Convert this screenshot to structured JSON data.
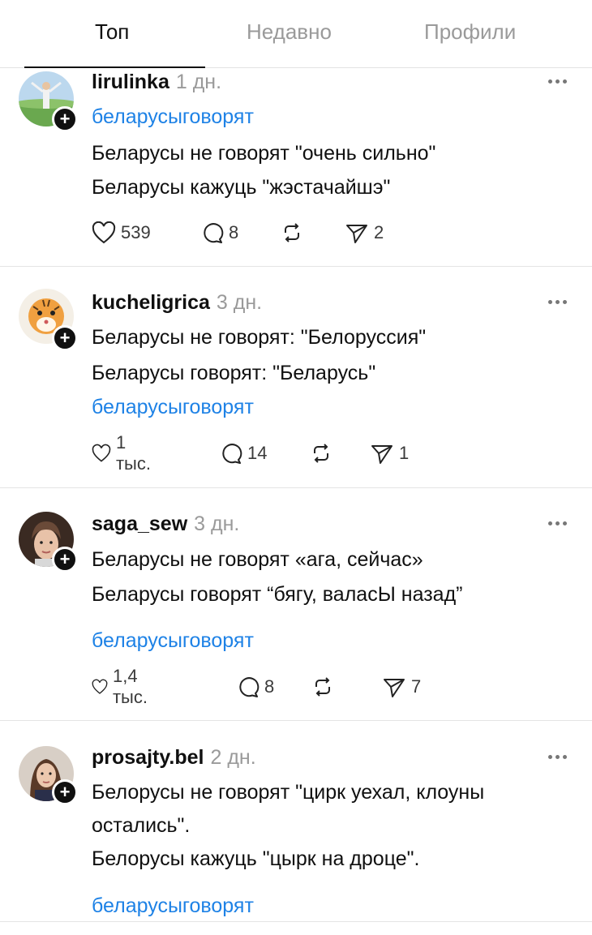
{
  "tabs": [
    {
      "label": "Топ"
    },
    {
      "label": "Недавно"
    },
    {
      "label": "Профили"
    }
  ],
  "posts": [
    {
      "username": "lirulinka",
      "time": "1 дн.",
      "tag": "беларусыговорят",
      "lines": [
        "Беларусы не говорят \"очень сильно\"",
        "Беларусы кажуць \"жэстачайшэ\""
      ],
      "likes": "539",
      "replies": "8",
      "reposts": "",
      "shares": "2"
    },
    {
      "username": "kucheligrica",
      "time": "3 дн.",
      "tag": "беларусыговорят",
      "lines": [
        "Беларусы не говорят: \"Белоруссия\"",
        "Беларусы говорят: \"Беларусь\""
      ],
      "likes": "1 тыс.",
      "replies": "14",
      "reposts": "",
      "shares": "1"
    },
    {
      "username": "saga_sew",
      "time": "3 дн.",
      "tag": "беларусыговорят",
      "lines": [
        "Беларусы не говорят «ага, сейчас»",
        "Беларусы говорят “бягу, валасЫ назад”"
      ],
      "likes": "1,4 тыс.",
      "replies": "8",
      "reposts": "",
      "shares": "7"
    },
    {
      "username": "prosajty.bel",
      "time": "2 дн.",
      "tag": "беларусыговорят",
      "lines": [
        "Белорусы не говорят \"цирк уехал, клоуны",
        "остались\".",
        "Белорусы кажуць \"цырк на дроце\"."
      ]
    }
  ],
  "colors": {
    "tag": "#1e82e6",
    "muted": "#9a9a9a",
    "text": "#101010",
    "divider": "#e4e4e4"
  },
  "icons": {
    "like": "heart-icon",
    "reply": "comment-bubble-icon",
    "repost": "repost-icon",
    "share": "send-icon",
    "more": "more-horizontal-icon",
    "follow": "plus-icon"
  }
}
